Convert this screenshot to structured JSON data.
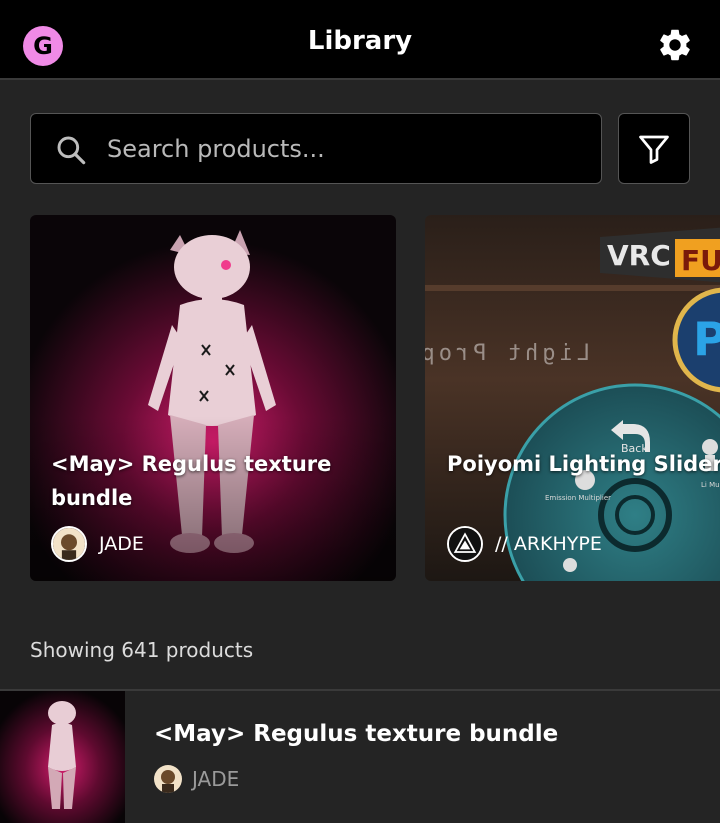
{
  "header": {
    "logo_letter": "G",
    "title": "Library",
    "settings_icon": "gear-icon",
    "accent_color": "#f08ae6"
  },
  "search": {
    "placeholder": "Search products...",
    "value": "",
    "icon": "search-icon",
    "filter_icon": "filter-icon"
  },
  "featured": [
    {
      "title": "<May> Regulus texture bundle",
      "creator": "JADE"
    },
    {
      "title": "Poiyomi Lighting Sliders Prefab!!",
      "creator": "// ARKHYPE"
    }
  ],
  "card2_art": {
    "banner": "VRC",
    "banner_accent": "FU",
    "mirror_text": "Light Prop",
    "back_label": "Back",
    "emission_label": "Emission Multiplier",
    "side_label": "Li Mu",
    "logo_letter": "P"
  },
  "list": {
    "count_text": "Showing 641 products",
    "items": [
      {
        "title": "<May> Regulus texture bundle",
        "creator": "JADE"
      }
    ]
  }
}
